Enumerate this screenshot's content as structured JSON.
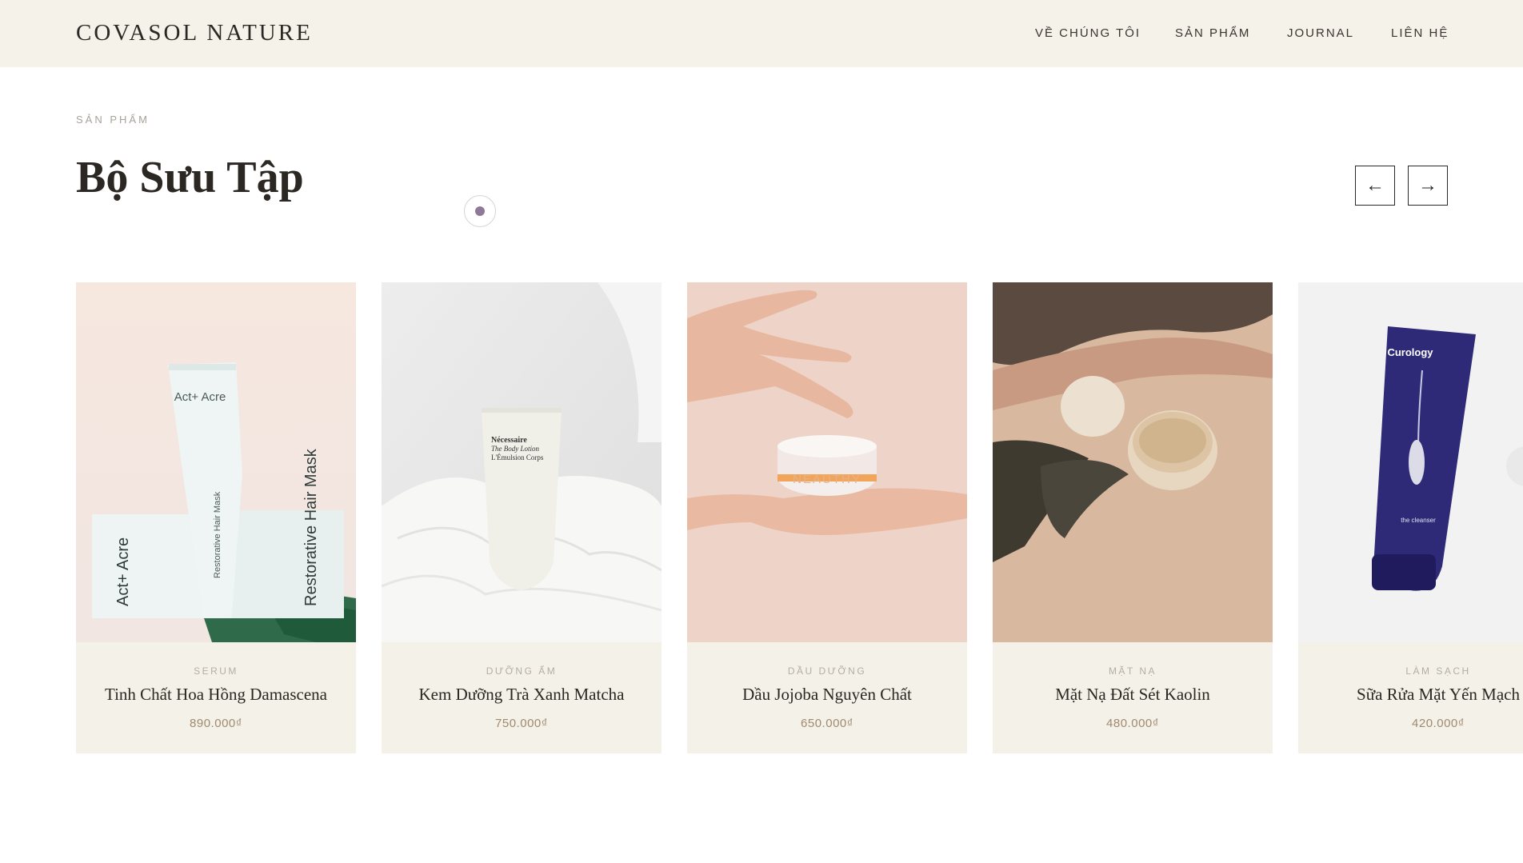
{
  "brand": {
    "logo": "COVASOL NATURE"
  },
  "nav": {
    "items": [
      {
        "label": "VỀ CHÚNG TÔI"
      },
      {
        "label": "SẢN PHẨM"
      },
      {
        "label": "JOURNAL"
      },
      {
        "label": "LIÊN HỆ"
      }
    ]
  },
  "section": {
    "eyebrow": "SẢN PHẨM",
    "title": "Bộ Sưu Tập",
    "prev_icon": "←",
    "next_icon": "→"
  },
  "products": [
    {
      "category": "SERUM",
      "name": "Tinh Chất Hoa Hồng Damascena",
      "price": "890.000₫",
      "image": {
        "brand": "Act+ Acre",
        "product": "Restorative Hair Mask"
      }
    },
    {
      "category": "DƯỠNG ẨM",
      "name": "Kem Dưỡng Trà Xanh Matcha",
      "price": "750.000₫",
      "image": {
        "brand": "Nécessaire",
        "line1": "The Body Lotion",
        "line2": "L'Émulsion Corps"
      }
    },
    {
      "category": "DẦU DƯỠNG",
      "name": "Dầu Jojoba Nguyên Chất",
      "price": "650.000₫",
      "image": {
        "brand": "NEAUTHY"
      }
    },
    {
      "category": "MẶT NẠ",
      "name": "Mặt Nạ Đất Sét Kaolin",
      "price": "480.000₫",
      "image": {}
    },
    {
      "category": "LÀM SẠCH",
      "name": "Sữa Rửa Mặt Yến Mạch",
      "price": "420.000₫",
      "image": {
        "brand": "Curology",
        "product": "the cleanser"
      }
    }
  ],
  "colors": {
    "header_bg": "#f5f2ea",
    "card_info_bg": "#f4f1e8",
    "price": "#a08a70",
    "accent_dot": "#8e7a96"
  }
}
